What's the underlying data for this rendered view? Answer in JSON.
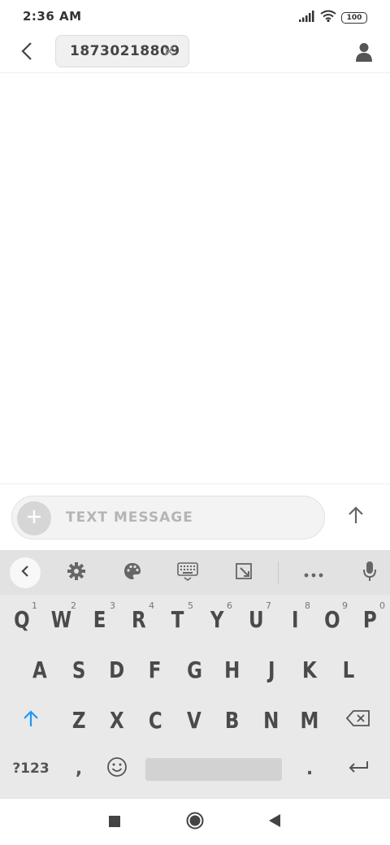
{
  "status_bar": {
    "time": "2:36 AM",
    "battery": "100"
  },
  "header": {
    "recipient": "18730218809"
  },
  "compose": {
    "placeholder": "TEXT MESSAGE"
  },
  "keyboard": {
    "row1": [
      {
        "label": "Q",
        "hint": "1"
      },
      {
        "label": "W",
        "hint": "2"
      },
      {
        "label": "E",
        "hint": "3"
      },
      {
        "label": "R",
        "hint": "4"
      },
      {
        "label": "T",
        "hint": "5"
      },
      {
        "label": "Y",
        "hint": "6"
      },
      {
        "label": "U",
        "hint": "7"
      },
      {
        "label": "I",
        "hint": "8"
      },
      {
        "label": "O",
        "hint": "9"
      },
      {
        "label": "P",
        "hint": "0"
      }
    ],
    "row2": [
      "A",
      "S",
      "D",
      "F",
      "G",
      "H",
      "J",
      "K",
      "L"
    ],
    "row3": [
      "Z",
      "X",
      "C",
      "V",
      "B",
      "N",
      "M"
    ],
    "symbols_label": "?123",
    "comma": ",",
    "period": "."
  },
  "colors": {
    "shift_accent": "#2196f3",
    "keyboard_bg": "#e9e9e9"
  },
  "icons": {
    "back": "chevron-left-icon",
    "chip_close": "close-icon",
    "contact": "person-icon",
    "attach": "plus-icon",
    "send": "arrow-up-icon"
  }
}
